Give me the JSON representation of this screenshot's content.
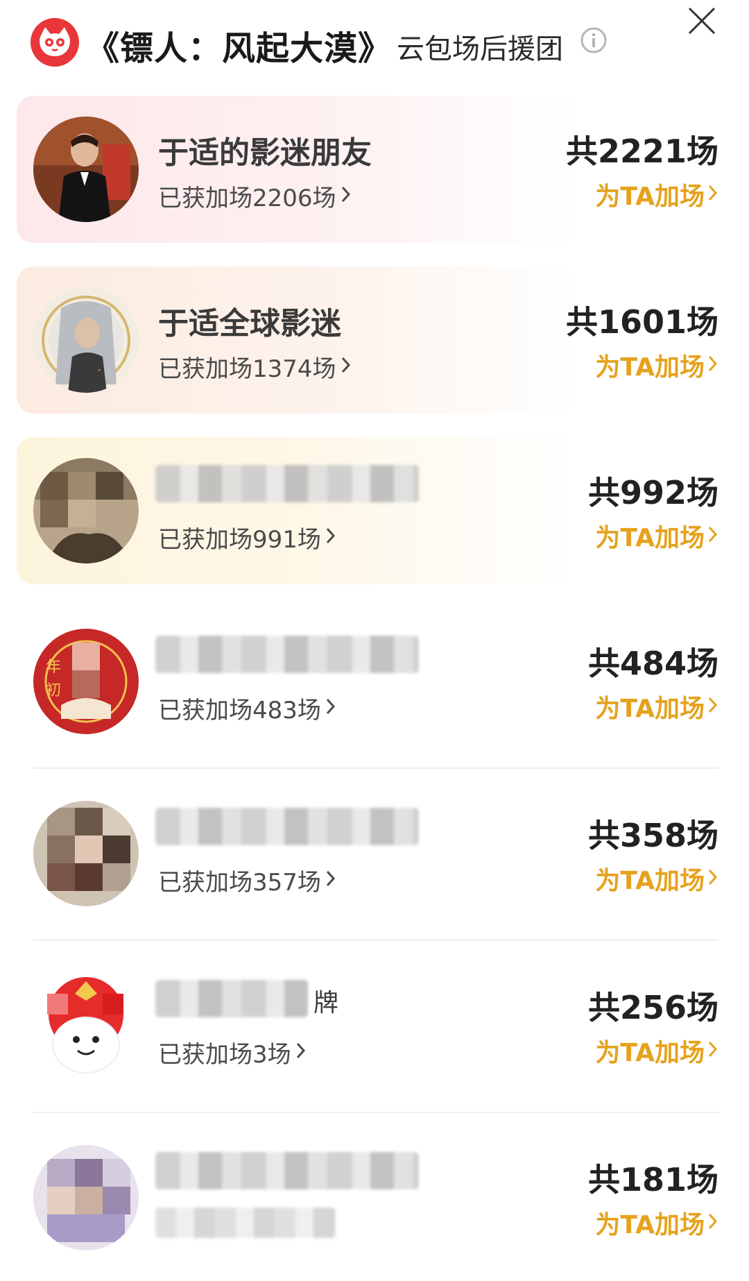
{
  "header": {
    "title": "《镖人：风起大漠》",
    "subtitle": "云包场后援团"
  },
  "rows": [
    {
      "name": "于适的影迷朋友",
      "sub": "已获加场2206场",
      "total": "共2221场",
      "action": "为TA加场"
    },
    {
      "name": "于适全球影迷",
      "sub": "已获加场1374场",
      "total": "共1601场",
      "action": "为TA加场"
    },
    {
      "name": "",
      "sub": "已获加场991场",
      "total": "共992场",
      "action": "为TA加场"
    },
    {
      "name": "",
      "sub": "已获加场483场",
      "total": "共484场",
      "action": "为TA加场"
    },
    {
      "name": "",
      "sub": "已获加场357场",
      "total": "共358场",
      "action": "为TA加场"
    },
    {
      "name": "牌",
      "sub": "已获加场3场",
      "total": "共256场",
      "action": "为TA加场"
    },
    {
      "name": "",
      "sub": "",
      "total": "共181场",
      "action": "为TA加场"
    }
  ]
}
